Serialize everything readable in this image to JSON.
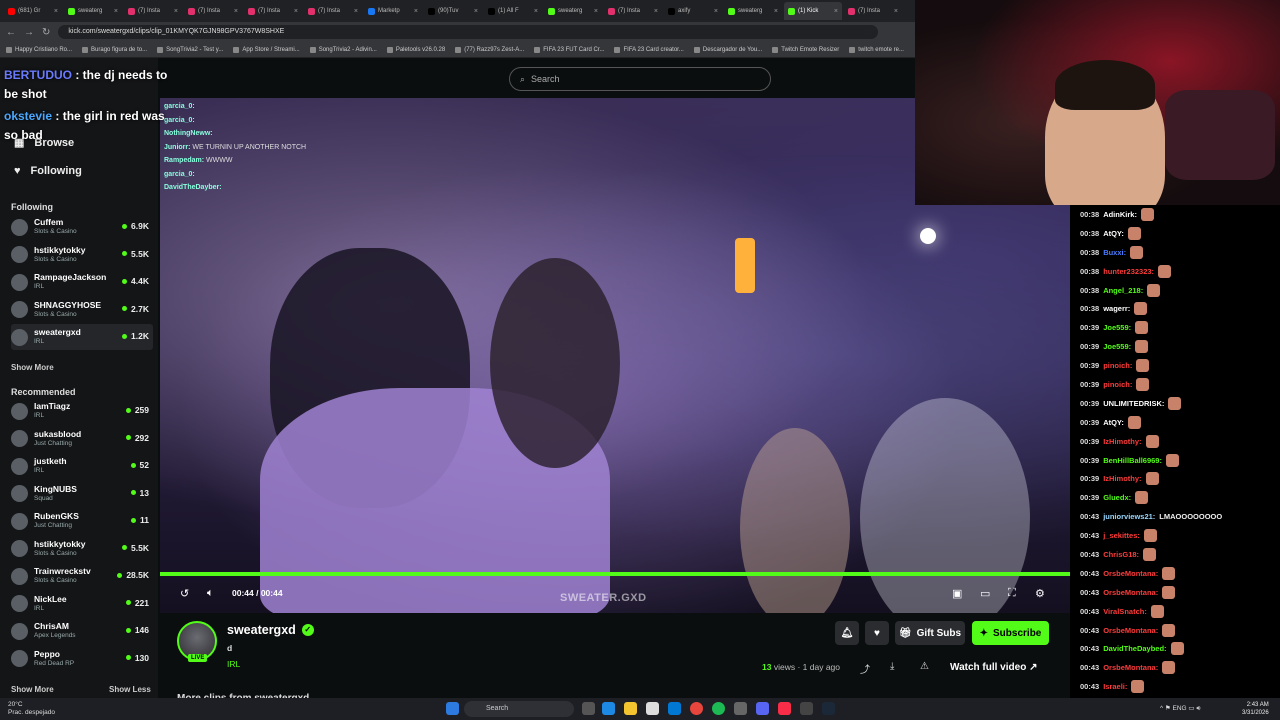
{
  "browser": {
    "tabs": [
      {
        "label": "(681) Gr",
        "color": "#ff0000"
      },
      {
        "label": "sweaterg",
        "color": "#53fc18"
      },
      {
        "label": "(7) Insta",
        "color": "#e1306c"
      },
      {
        "label": "(7) Insta",
        "color": "#e1306c"
      },
      {
        "label": "(7) Insta",
        "color": "#e1306c"
      },
      {
        "label": "(7) Insta",
        "color": "#e1306c"
      },
      {
        "label": "Marketp",
        "color": "#1877f2"
      },
      {
        "label": "(90)Tuv",
        "color": "#000000"
      },
      {
        "label": "(1) All F",
        "color": "#000000"
      },
      {
        "label": "sweaterg",
        "color": "#53fc18"
      },
      {
        "label": "(7) Insta",
        "color": "#e1306c"
      },
      {
        "label": "axify",
        "color": "#000000"
      },
      {
        "label": "sweaterg",
        "color": "#53fc18"
      },
      {
        "label": "(1) Kick",
        "color": "#53fc18"
      },
      {
        "label": "(7) Insta",
        "color": "#e1306c"
      }
    ],
    "url": "kick.com/sweatergxd/clips/clip_01KMYQK7GJN98GPV3767W8SHXE",
    "bookmarks": [
      "Happy Cristiano Ro...",
      "Burago figura de to...",
      "SongTrivia2 - Test y...",
      "App Store / Streami...",
      "SongTrivia2 - Adivin...",
      "Paletools v26.0.28",
      "(77) Razz97s Zest-A...",
      "FIFA 23 FUT Card Cr...",
      "FIFA 23 Card creator...",
      "Descargador de You...",
      "Twitch Emote Resizer",
      "twitch emote re..."
    ]
  },
  "search": {
    "placeholder": "Search"
  },
  "overlay_top": {
    "line1_user": "BERTUDUO",
    "line1_text": ": the dj needs to",
    "line2_text": "be shot",
    "line3_user": "okstevie",
    "line3_text": ": the girl in red was",
    "line4_text": "so bad"
  },
  "sidebar": {
    "nav": [
      {
        "label": "Browse",
        "icon": "compass-icon"
      },
      {
        "label": "Following",
        "icon": "heart-icon"
      }
    ],
    "following_title": "Following",
    "following": [
      {
        "name": "Cuffem",
        "category": "Slots & Casino",
        "viewers": "6.9K"
      },
      {
        "name": "hstikkytokky",
        "category": "Slots & Casino",
        "viewers": "5.5K"
      },
      {
        "name": "RampageJackson",
        "category": "IRL",
        "viewers": "4.4K"
      },
      {
        "name": "SHNAGGYHOSE",
        "category": "Slots & Casino",
        "viewers": "2.7K"
      },
      {
        "name": "sweatergxd",
        "category": "IRL",
        "viewers": "1.2K"
      }
    ],
    "show_more": "Show More",
    "recommended_title": "Recommended",
    "recommended": [
      {
        "name": "IamTiagz",
        "category": "IRL",
        "viewers": "259"
      },
      {
        "name": "sukasblood",
        "category": "Just Chatting",
        "viewers": "292"
      },
      {
        "name": "justketh",
        "category": "IRL",
        "viewers": "52"
      },
      {
        "name": "KingNUBS",
        "category": "Squad",
        "viewers": "13"
      },
      {
        "name": "RubenGKS",
        "category": "Just Chatting",
        "viewers": "11"
      },
      {
        "name": "hstikkytokky",
        "category": "Slots & Casino",
        "viewers": "5.5K"
      },
      {
        "name": "Trainwreckstv",
        "category": "Slots & Casino",
        "viewers": "28.5K"
      },
      {
        "name": "NickLee",
        "category": "IRL",
        "viewers": "221"
      },
      {
        "name": "ChrisAM",
        "category": "Apex Legends",
        "viewers": "146"
      },
      {
        "name": "Peppo",
        "category": "Red Dead RP",
        "viewers": "130"
      }
    ],
    "show_more_2": "Show More",
    "show_less": "Show Less"
  },
  "video": {
    "chat_overlay": [
      {
        "user": "garcia_0:",
        "text": ""
      },
      {
        "user": "garcia_0:",
        "text": ""
      },
      {
        "user": "NothingNeww:",
        "text": ""
      },
      {
        "user": "",
        "text": ""
      },
      {
        "user": "Juniorr:",
        "text": "WE TURNIN UP ANOTHER NOTCH"
      },
      {
        "user": "Rampedam:",
        "text": "WWWW"
      },
      {
        "user": "garcia_0:",
        "text": ""
      },
      {
        "user": "DavidTheDayber:",
        "text": ""
      }
    ],
    "time": "00:44 / 00:44",
    "progress": 1.0,
    "watermark": "SWEATER.GXD"
  },
  "clip": {
    "channel": "sweatergxd",
    "live": "LIVE",
    "title": "d",
    "category": "IRL",
    "gift_subs": "Gift Subs",
    "subscribe": "Subscribe",
    "views": "13",
    "views_label": "views",
    "ago": "1 day ago",
    "watch_full": "Watch full video",
    "more_clips": "More clips from sweatergxd"
  },
  "right_chat": [
    {
      "time": "00:38",
      "user": "AdinKirk:",
      "color": "#ffffff",
      "text": ""
    },
    {
      "time": "00:38",
      "user": "AtQY:",
      "color": "#ffffff",
      "text": ""
    },
    {
      "time": "00:38",
      "user": "Buxxi:",
      "color": "#4a7cff",
      "text": ""
    },
    {
      "time": "00:38",
      "user": "hunter232323:",
      "color": "#ff3b3b",
      "text": ""
    },
    {
      "time": "00:38",
      "user": "Angel_218:",
      "color": "#53fc18",
      "text": ""
    },
    {
      "time": "00:38",
      "user": "wagerr:",
      "color": "#ffffff",
      "text": ""
    },
    {
      "time": "00:39",
      "user": "Joe559:",
      "color": "#53fc18",
      "text": ""
    },
    {
      "time": "00:39",
      "user": "Joe559:",
      "color": "#53fc18",
      "text": ""
    },
    {
      "time": "00:39",
      "user": "pinoich:",
      "color": "#ff3b3b",
      "text": ""
    },
    {
      "time": "00:39",
      "user": "pinoich:",
      "color": "#ff3b3b",
      "text": ""
    },
    {
      "time": "00:39",
      "user": "UNLIMITEDRISK:",
      "color": "#ffffff",
      "text": ""
    },
    {
      "time": "00:39",
      "user": "AtQY:",
      "color": "#ffffff",
      "text": ""
    },
    {
      "time": "00:39",
      "user": "IzHimothy:",
      "color": "#ff3b3b",
      "text": ""
    },
    {
      "time": "00:39",
      "user": "BenHillBall6969:",
      "color": "#53fc18",
      "text": ""
    },
    {
      "time": "00:39",
      "user": "IzHimothy:",
      "color": "#ff3b3b",
      "text": ""
    },
    {
      "time": "00:39",
      "user": "Gluedx:",
      "color": "#53fc18",
      "text": ""
    },
    {
      "time": "00:43",
      "user": "juniorviews21:",
      "color": "#9ad7ff",
      "text": "LMAOOOOOOOO"
    },
    {
      "time": "00:43",
      "user": "j_sekittes:",
      "color": "#ff3b3b",
      "text": ""
    },
    {
      "time": "00:43",
      "user": "ChrisG18:",
      "color": "#ff3b3b",
      "text": ""
    },
    {
      "time": "00:43",
      "user": "OrsbeMontana:",
      "color": "#ff3b3b",
      "text": ""
    },
    {
      "time": "00:43",
      "user": "OrsbeMontana:",
      "color": "#ff3b3b",
      "text": ""
    },
    {
      "time": "00:43",
      "user": "ViralSnatch:",
      "color": "#ff3b3b",
      "text": ""
    },
    {
      "time": "00:43",
      "user": "OrsbeMontana:",
      "color": "#ff3b3b",
      "text": ""
    },
    {
      "time": "00:43",
      "user": "DavidTheDaybed:",
      "color": "#53fc18",
      "text": ""
    },
    {
      "time": "00:43",
      "user": "OrsbeMontana:",
      "color": "#ff3b3b",
      "text": ""
    },
    {
      "time": "00:43",
      "user": "Israeli:",
      "color": "#ff3b3b",
      "text": ""
    }
  ],
  "taskbar": {
    "weather_temp": "20°C",
    "weather_desc": "Prac. despejado",
    "search": "Search",
    "lang": "ENG",
    "time": "2:43 AM",
    "date": "3/31/2026"
  }
}
